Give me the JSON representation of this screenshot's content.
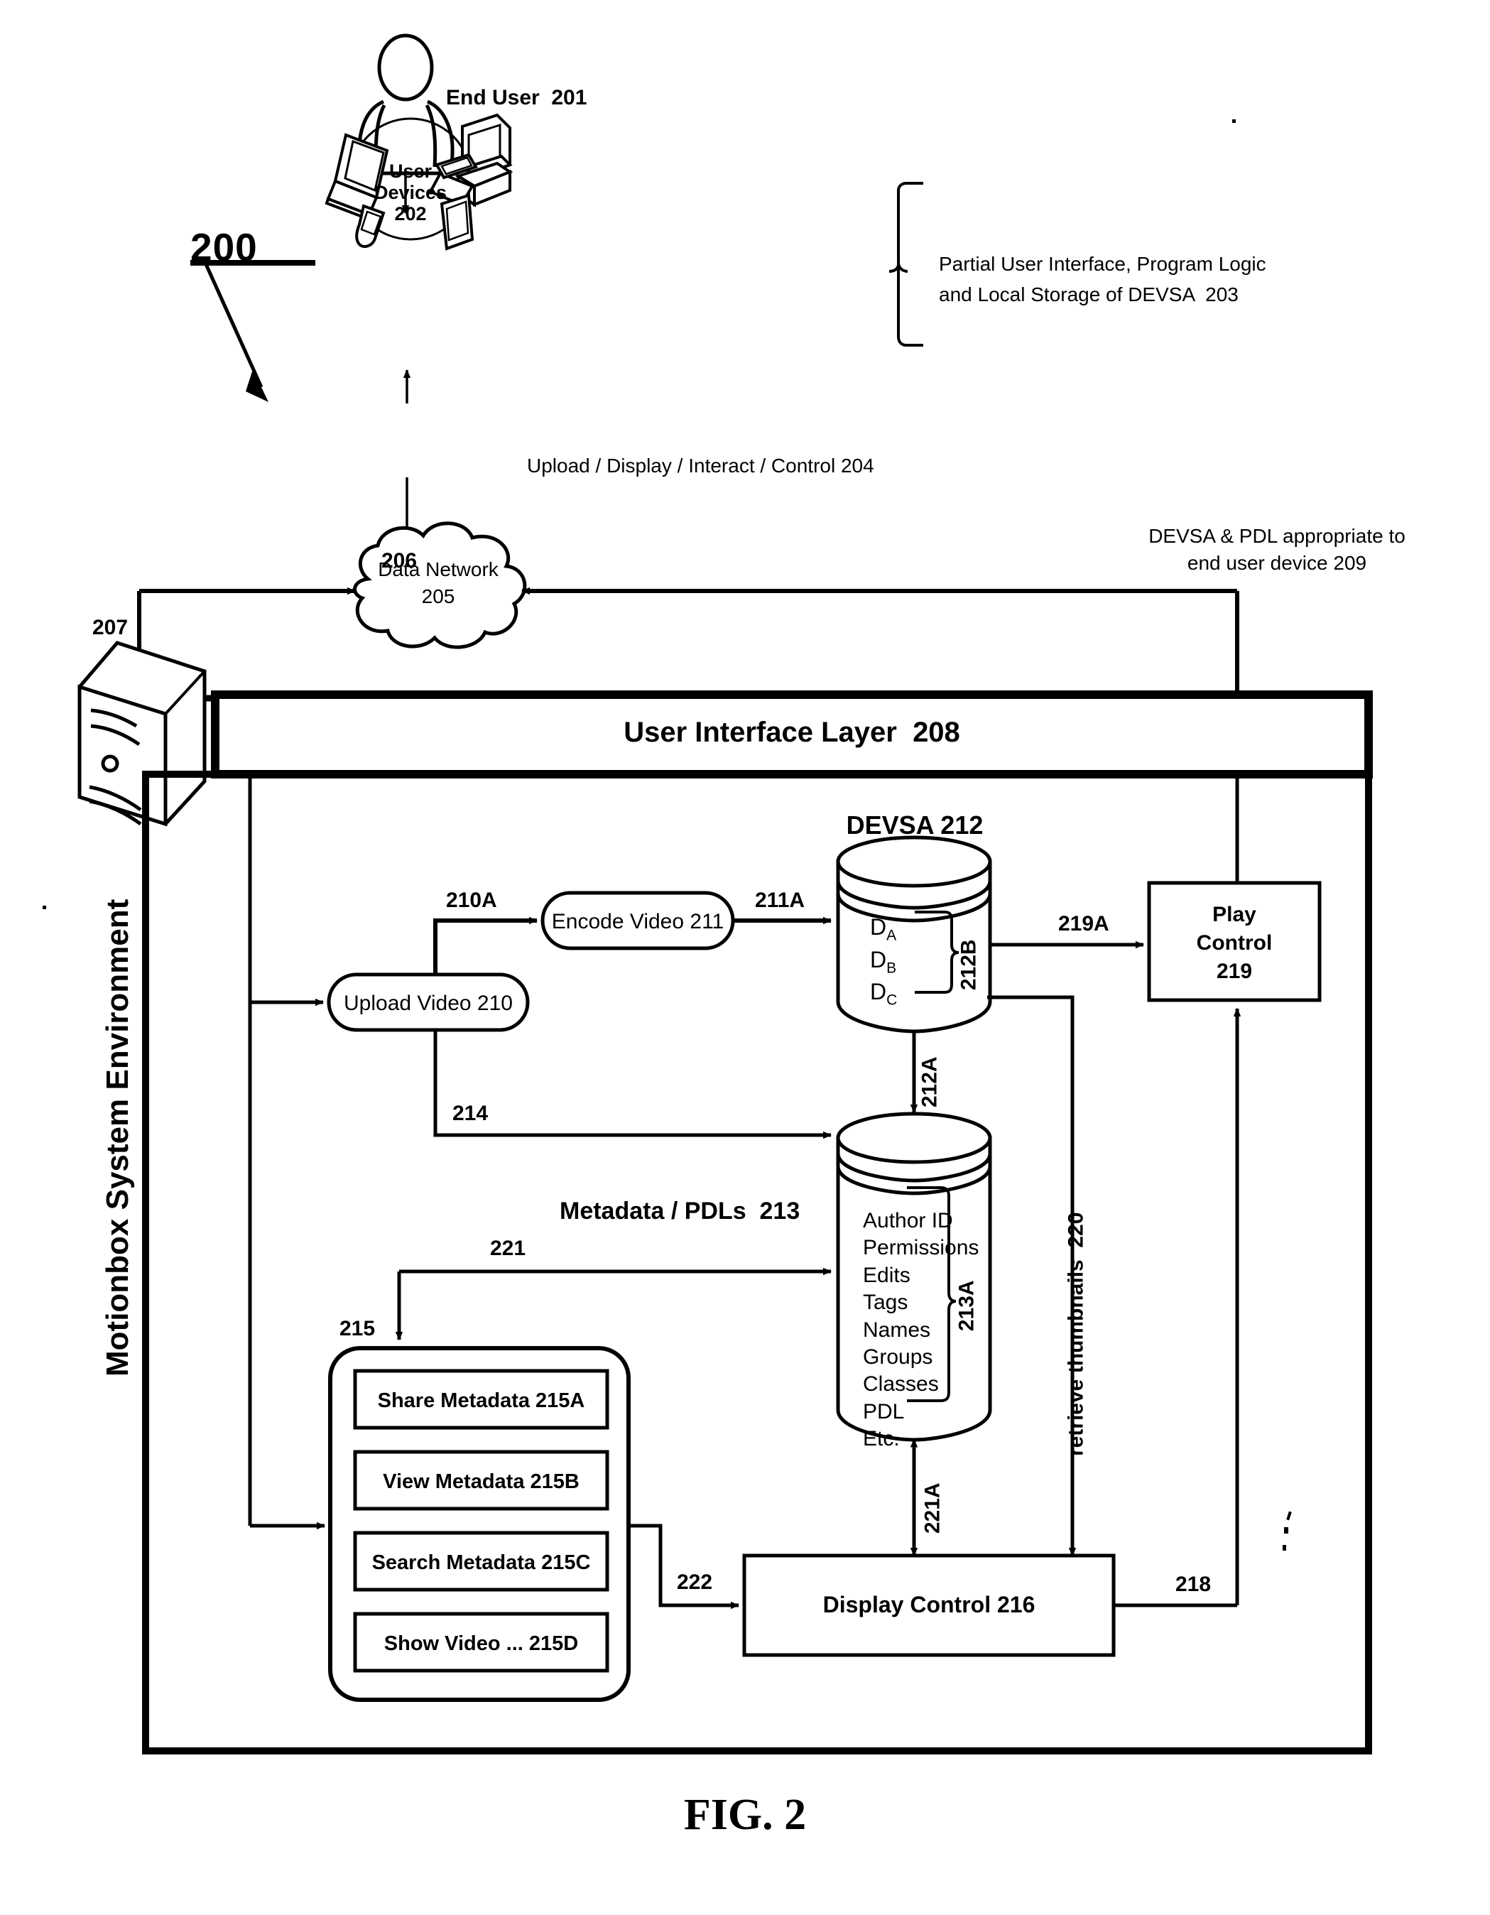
{
  "figure": {
    "caption": "FIG. 2",
    "diagram_ref": "200"
  },
  "actors": {
    "end_user": "End User  201",
    "user_devices_line1": "User",
    "user_devices_line2": "Devices",
    "user_devices_line3": "202"
  },
  "annotations": {
    "bracket_devsa_line1": "Partial User Interface, Program Logic",
    "bracket_devsa_line2": "and Local Storage of DEVSA  203",
    "upload_display_interact_control": "Upload / Display / Interact / Control 204",
    "devsa_pdl_line1": "DEVSA & PDL appropriate to",
    "devsa_pdl_line2": "end user device 209",
    "retrieve_thumbnails": "retrieve thumbnails  220"
  },
  "network": {
    "cloud_line1": "Data Network",
    "cloud_line2": "205"
  },
  "environment": {
    "vertical_title": "Motionbox System Environment",
    "server_ref": "207",
    "ui_layer": "User Interface Layer  208"
  },
  "nodes": {
    "upload_video": "Upload Video 210",
    "encode_video": "Encode Video 211",
    "devsa_title": "DEVSA 212",
    "devsa_items": [
      "D",
      "D",
      "D"
    ],
    "devsa_sub": [
      "A",
      "B",
      "C"
    ],
    "devsa_brace_ref": "212B",
    "metadata_title": "Metadata / PDLs  213",
    "metadata_items": [
      "Author ID",
      "Permissions",
      "Edits",
      "Tags",
      "Names",
      "Groups",
      "Classes",
      "PDL",
      "Etc."
    ],
    "metadata_brace_ref": "213A",
    "play_control_line1": "Play",
    "play_control_line2": "Control",
    "play_control_line3": "219",
    "display_control": "Display Control 216",
    "group_ref": "215",
    "group_items": [
      "Share Metadata 215A",
      "View Metadata 215B",
      "Search Metadata 215C",
      "Show Video ... 215D"
    ]
  },
  "edges": {
    "e206": "206",
    "e210A": "210A",
    "e211A": "211A",
    "e212A": "212A",
    "e214": "214",
    "e218": "218",
    "e219A": "219A",
    "e221": "221",
    "e221A": "221A",
    "e222": "222"
  },
  "colors": {
    "ink": "#000000",
    "paper": "#ffffff"
  }
}
